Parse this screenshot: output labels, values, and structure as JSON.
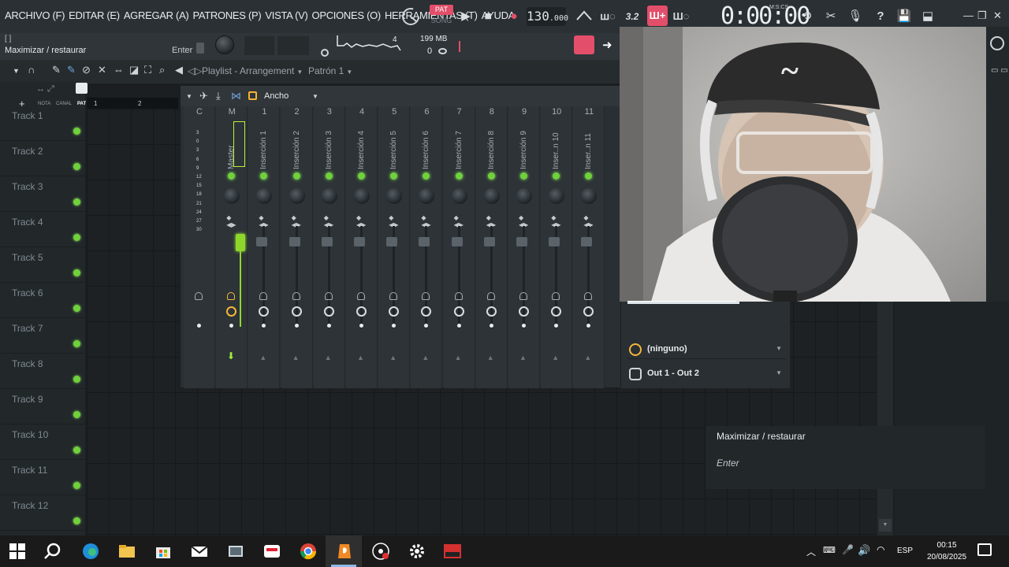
{
  "menu": [
    "ARCHIVO (F)",
    "EDITAR (E)",
    "AGREGAR (A)",
    "PATRONES (P)",
    "VISTA (V)",
    "OPCIONES (O)",
    "HERRAMIENTAS (T)",
    "AYUDA"
  ],
  "transport": {
    "pat_label": "PAT",
    "song_label": "SONG",
    "tempo_int": "130",
    "tempo_frac": ".000",
    "time": "0:00:00",
    "time_format": "M:S:CS",
    "counter": "3.2"
  },
  "hint": {
    "brackets": "[ ]",
    "title": "Maximizar / restaurar",
    "shortcut": "Enter"
  },
  "cpu": {
    "voices": "4",
    "memory": "199 MB",
    "polyphony": "0"
  },
  "playlist": {
    "title": "Playlist - Arrangement",
    "pattern": "Patrón 1",
    "ruler": [
      "1",
      "2"
    ],
    "tags": [
      "NOTA",
      "CANAL",
      "PAT"
    ],
    "add": "+"
  },
  "tracks": [
    "Track 1",
    "Track 2",
    "Track 3",
    "Track 4",
    "Track 5",
    "Track 6",
    "Track 7",
    "Track 8",
    "Track 9",
    "Track 10",
    "Track 11",
    "Track 12"
  ],
  "mixer": {
    "width_label": "Ancho",
    "db_scale": [
      "3",
      "0",
      "3",
      "6",
      "9",
      "12",
      "15",
      "18",
      "21",
      "24",
      "27",
      "30"
    ],
    "strips": [
      {
        "num": "C",
        "name": ""
      },
      {
        "num": "M",
        "name": "Master"
      },
      {
        "num": "1",
        "name": "Inserción 1"
      },
      {
        "num": "2",
        "name": "Inserción 2"
      },
      {
        "num": "3",
        "name": "Inserción 3"
      },
      {
        "num": "4",
        "name": "Inserción 4"
      },
      {
        "num": "5",
        "name": "Inserción 5"
      },
      {
        "num": "6",
        "name": "Inserción 6"
      },
      {
        "num": "7",
        "name": "Inserción 7"
      },
      {
        "num": "8",
        "name": "Inserción 8"
      },
      {
        "num": "9",
        "name": "Inserción 9"
      },
      {
        "num": "10",
        "name": "Inser..n 10"
      },
      {
        "num": "11",
        "name": "Inser..n 11"
      }
    ],
    "input": "(ninguno)",
    "output": "Out 1 - Out 2"
  },
  "popup": {
    "title": "Maximizar / restaurar",
    "hint": "Enter"
  },
  "tray": {
    "lang": "ESP",
    "time": "00:15",
    "date": "20/08/2025"
  },
  "colors": {
    "accent": "#e34e6a",
    "led": "#6fd13b",
    "master": "#9ef03a",
    "warn": "#f3b83a"
  }
}
